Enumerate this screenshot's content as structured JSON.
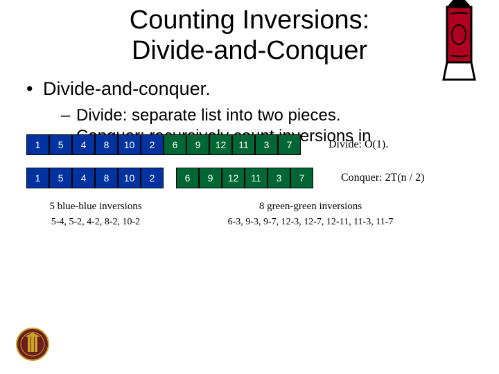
{
  "title_line1": "Counting Inversions:",
  "title_line2": "Divide-and-Conquer",
  "bullet_main": "Divide-and-conquer.",
  "sub1": "Divide:  separate list into two pieces.",
  "sub2": "Conquer: recursively count inversions in",
  "row1": {
    "cells": [
      "1",
      "5",
      "4",
      "8",
      "10",
      "2",
      "6",
      "9",
      "12",
      "11",
      "3",
      "7"
    ],
    "label": "Divide:  O(1)."
  },
  "row2": {
    "left": [
      "1",
      "5",
      "4",
      "8",
      "10",
      "2"
    ],
    "right": [
      "6",
      "9",
      "12",
      "11",
      "3",
      "7"
    ],
    "label": "Conquer:  2T(n / 2)"
  },
  "inv": {
    "blue_title": "5 blue-blue inversions",
    "blue_list": "5-4, 5-2, 4-2, 8-2, 10-2",
    "green_title": "8 green-green inversions",
    "green_list": "6-3, 9-3, 9-7, 12-3, 12-7, 12-11, 11-3, 11-7"
  }
}
